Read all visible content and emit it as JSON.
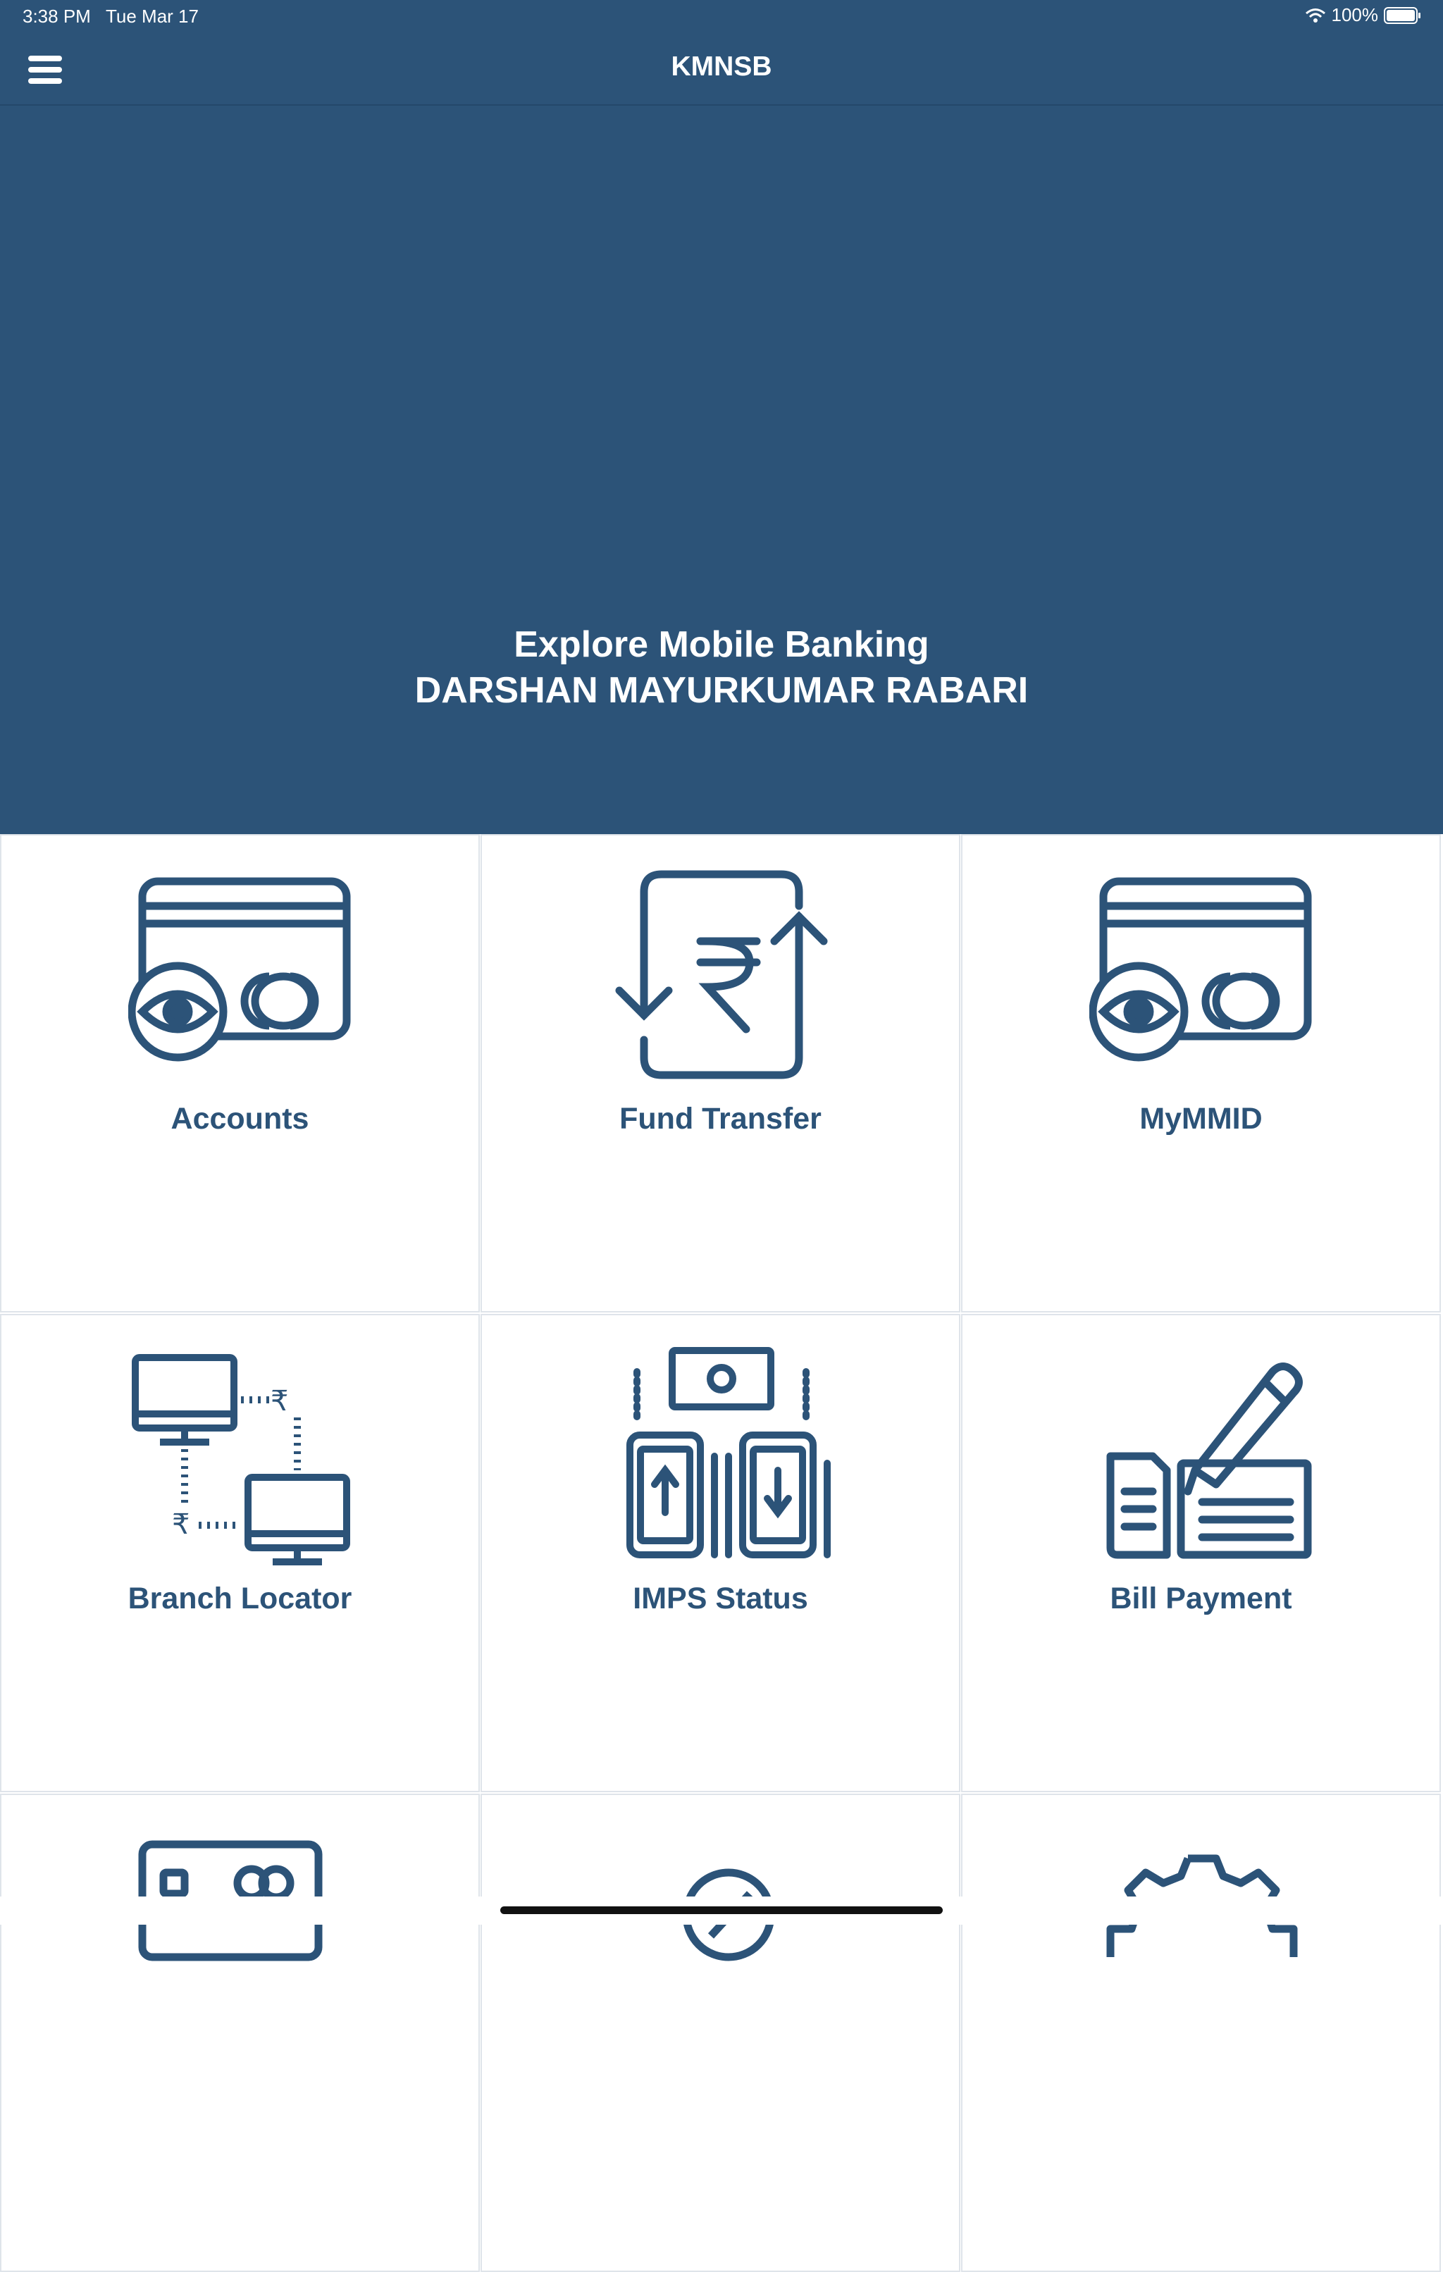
{
  "status_bar": {
    "time": "3:38 PM",
    "date": "Tue Mar 17",
    "battery": "100%"
  },
  "header": {
    "title": "KMNSB"
  },
  "hero": {
    "line1": "Explore Mobile Banking",
    "line2": "DARSHAN MAYURKUMAR RABARI"
  },
  "tiles": [
    {
      "label": "Accounts",
      "icon": "card-eye-icon"
    },
    {
      "label": "Fund Transfer",
      "icon": "rupee-transfer-icon"
    },
    {
      "label": "MyMMID",
      "icon": "card-eye-icon"
    },
    {
      "label": "Branch Locator",
      "icon": "computers-rupee-icon"
    },
    {
      "label": "IMPS Status",
      "icon": "phones-money-icon"
    },
    {
      "label": "Bill Payment",
      "icon": "cheque-pen-icon"
    }
  ],
  "colors": {
    "primary": "#2c5378",
    "background": "#ffffff",
    "divider": "#dfe4ea"
  }
}
